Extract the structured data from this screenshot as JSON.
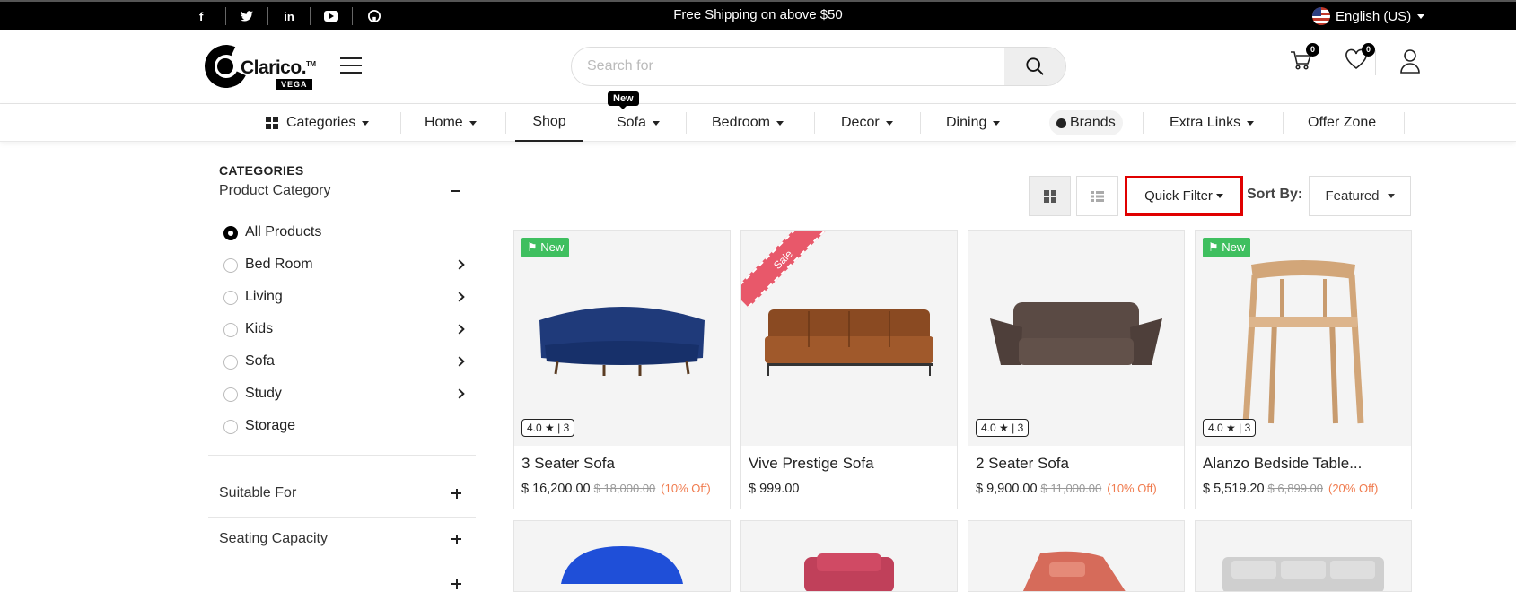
{
  "topbar": {
    "social": [
      "f",
      "t",
      "in",
      "yt",
      "gh"
    ],
    "shipping": "Free Shipping on above $50",
    "language": "English (US)"
  },
  "header": {
    "logo_text": "Clarico.",
    "logo_sub": "VEGA",
    "search_placeholder": "Search for",
    "cart_count": "0",
    "wishlist_count": "0"
  },
  "nav": {
    "new_tag": "New",
    "items": [
      "Categories",
      "Home",
      "Shop",
      "Sofa",
      "Bedroom",
      "Decor",
      "Dining",
      "Brands",
      "Extra Links",
      "Offer Zone"
    ]
  },
  "sidebar": {
    "heading": "CATEGORIES",
    "product_category": "Product Category",
    "categories": [
      "All Products",
      "Bed Room",
      "Living",
      "Kids",
      "Sofa",
      "Study",
      "Storage"
    ],
    "filters": [
      "Suitable For",
      "Seating Capacity"
    ]
  },
  "toolbar": {
    "quick_filter": "Quick Filter",
    "sort_label": "Sort By:",
    "sort_value": "Featured"
  },
  "products": [
    {
      "name": "3 Seater Sofa",
      "price": "$ 16,200.00",
      "old_price": "$ 18,000.00",
      "discount": "(10% Off)",
      "tag": "New",
      "rating": "4.0",
      "reviews": "3"
    },
    {
      "name": "Vive Prestige Sofa",
      "price": "$ 999.00",
      "tag": "Sale"
    },
    {
      "name": "2 Seater Sofa",
      "price": "$ 9,900.00",
      "old_price": "$ 11,000.00",
      "discount": "(10% Off)",
      "rating": "4.0",
      "reviews": "3"
    },
    {
      "name": "Alanzo Bedside Table...",
      "price": "$ 5,519.20",
      "old_price": "$ 6,899.00",
      "discount": "(20% Off)",
      "tag": "New",
      "rating": "4.0",
      "reviews": "3"
    }
  ],
  "colors": {
    "accent": "#000000",
    "new_tag": "#3fbf5f",
    "sale": "#e8586a",
    "discount": "#f07b4e",
    "highlight": "#e00000"
  }
}
